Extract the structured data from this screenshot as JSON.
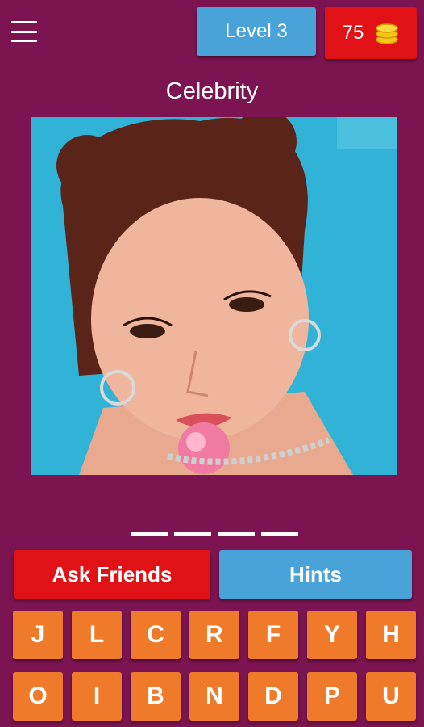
{
  "header": {
    "menu_icon": "hamburger-menu-icon",
    "level_label": "Level 3",
    "coins": "75",
    "coin_icon": "coin-stack-icon"
  },
  "category": "Celebrity",
  "answer_slots": 4,
  "actions": {
    "ask_friends_label": "Ask Friends",
    "hints_label": "Hints"
  },
  "keyboard": {
    "row1": [
      "J",
      "L",
      "C",
      "R",
      "F",
      "Y",
      "H"
    ],
    "row2": [
      "O",
      "I",
      "B",
      "N",
      "D",
      "P",
      "U"
    ]
  },
  "colors": {
    "background": "#7b1450",
    "level_button": "#4aa3d8",
    "coins_box": "#e01216",
    "ask_friends": "#e01216",
    "hints": "#4aa3d8",
    "key": "#ee7a2a"
  }
}
